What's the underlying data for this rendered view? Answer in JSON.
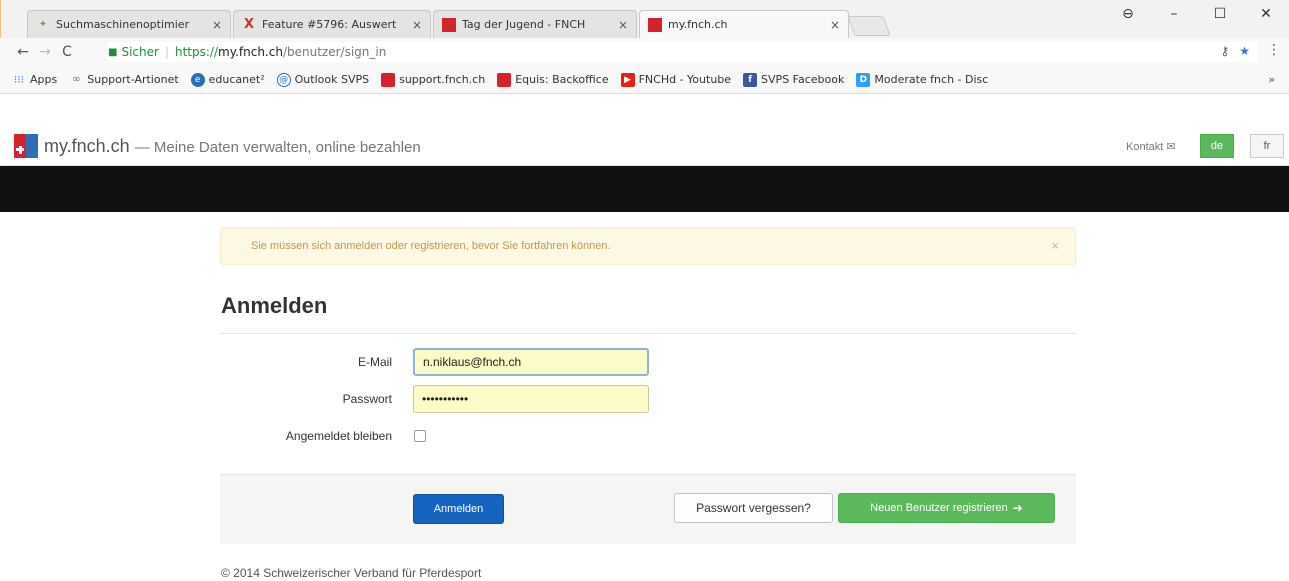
{
  "browser": {
    "tabs": [
      {
        "title": "Suchmaschinenoptimier",
        "icon": "artionet-icon",
        "close": "×"
      },
      {
        "title": "Feature #5796: Auswert",
        "icon": "redmine-x-icon",
        "close": "×"
      },
      {
        "title": "Tag der Jugend - FNCH",
        "icon": "fnch-icon",
        "close": "×"
      },
      {
        "title": "my.fnch.ch",
        "icon": "fnch-icon",
        "close": "×"
      }
    ],
    "window_controls": {
      "profile": "⊖",
      "minimize": "–",
      "maximize": "☐",
      "close": "✕"
    },
    "nav": {
      "back": "←",
      "forward": "→",
      "reload": "C"
    },
    "address": {
      "secure_label": "Sicher",
      "scheme": "https://",
      "host": "my.fnch.ch",
      "path": "/benutzer/sign_in"
    },
    "bookmarks": [
      {
        "label": "Apps",
        "icon": "apps-grid-icon",
        "color": "#4285f4"
      },
      {
        "label": "Support-Artionet",
        "icon": "artionet-icon",
        "color": "#6d6d6d"
      },
      {
        "label": "educanet²",
        "icon": "educanet-icon",
        "color": "#2a6ebb"
      },
      {
        "label": "Outlook SVPS",
        "icon": "outlook-icon",
        "color": "#2a6ebb"
      },
      {
        "label": "support.fnch.ch",
        "icon": "fnch-icon",
        "color": "#d8212f"
      },
      {
        "label": "Equis: Backoffice",
        "icon": "fnch-icon",
        "color": "#d8212f"
      },
      {
        "label": "FNCHd - Youtube",
        "icon": "youtube-icon",
        "color": "#e62117"
      },
      {
        "label": "SVPS Facebook",
        "icon": "facebook-icon",
        "color": "#3b5998"
      },
      {
        "label": "Moderate fnch - Disc",
        "icon": "disqus-icon",
        "color": "#2e9fff"
      }
    ],
    "bookmarks_more": "»"
  },
  "site": {
    "brand": "my.fnch.ch",
    "tagline": "— Meine Daten verwalten, online bezahlen",
    "contact": "Kontakt ✉",
    "lang_active": "de",
    "lang_other": "fr"
  },
  "alert": {
    "message": "Sie müssen sich anmelden oder registrieren, bevor Sie fortfahren können.",
    "close": "×"
  },
  "form": {
    "heading": "Anmelden",
    "email_label": "E-Mail",
    "email_value": "n.niklaus@fnch.ch",
    "password_label": "Passwort",
    "password_value": "•••••••••••",
    "remember_label": "Angemeldet bleiben",
    "submit_label": "Anmelden",
    "forgot_label": "Passwort vergessen?",
    "register_label": "Neuen Benutzer registrieren",
    "register_icon": "➔"
  },
  "footer": {
    "copyright": "© 2014 Schweizerischer Verband für Pferdesport"
  },
  "colors": {
    "primary": "#1565c0",
    "success": "#5cb85c",
    "alert_bg": "#fcf8e3",
    "alert_text": "#c09853",
    "darkbar": "#111111",
    "autofill": "#fcfbc7"
  }
}
